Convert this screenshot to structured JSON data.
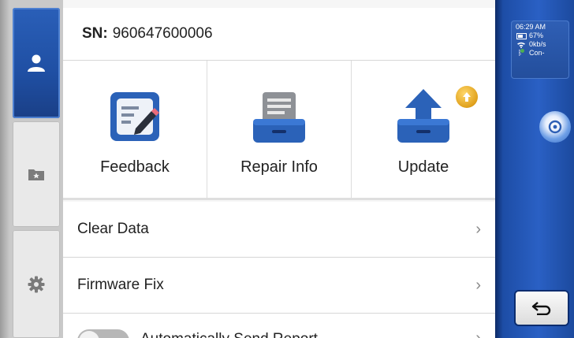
{
  "header": {
    "sn_label": "SN:",
    "sn_value": "960647600006"
  },
  "tiles": [
    {
      "label": "Feedback",
      "icon": "feedback-icon"
    },
    {
      "label": "Repair Info",
      "icon": "repair-info-icon"
    },
    {
      "label": "Update",
      "icon": "update-icon",
      "badge": "update-available-badge-icon"
    }
  ],
  "menu": {
    "items": [
      {
        "label": "Clear Data",
        "icon": "chevron-right-icon"
      },
      {
        "label": "Firmware Fix",
        "icon": "chevron-right-icon"
      },
      {
        "label": "Automatically Send Report",
        "icon": "chevron-right-icon",
        "toggle_on": false
      }
    ]
  },
  "left_rail": {
    "tabs": [
      {
        "icon": "user-icon",
        "active": true
      },
      {
        "icon": "star-folder-icon",
        "active": false
      },
      {
        "icon": "gear-icon",
        "active": false
      }
    ]
  },
  "status": {
    "time": "06:29 AM",
    "battery": "67%",
    "network": "0kb/s",
    "bluetooth": "Con-"
  },
  "right_rail": {
    "float_icon": "assistant-icon",
    "back_icon": "back-arrow-icon"
  },
  "colors": {
    "accent_blue": "#1f4fa3",
    "rail_blue": "#2a60c4",
    "badge_gold": "#e0a11c",
    "icon_blue": "#2b62b8"
  }
}
